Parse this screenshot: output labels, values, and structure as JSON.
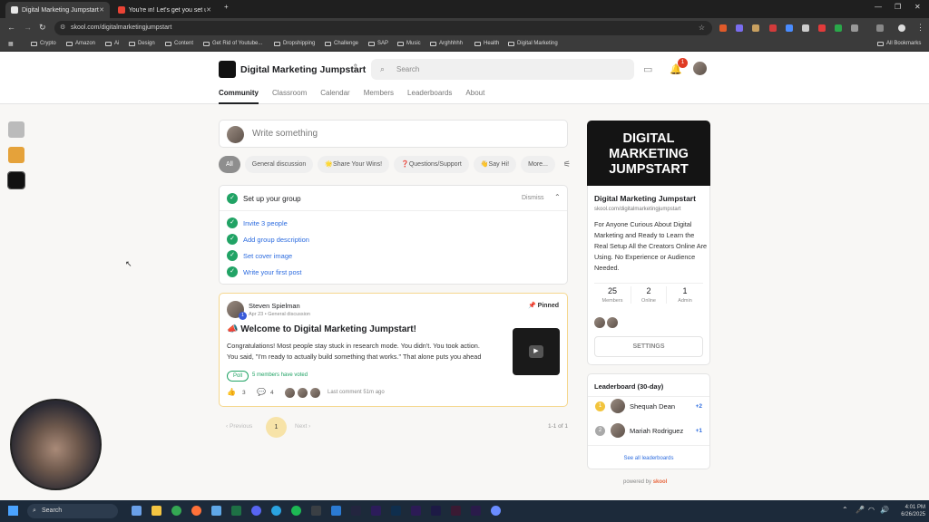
{
  "browser": {
    "tabs": [
      {
        "label": "Digital Marketing Jumpstart",
        "active": true
      },
      {
        "label": "You're in! Let's get you set up...",
        "active": false
      }
    ],
    "url": "skool.com/digitalmarketingjumpstart",
    "bookmarks": [
      "Crypto",
      "Amazon",
      "Ai",
      "Design",
      "Content",
      "Get Rid of Youtube...",
      "Dropshipping",
      "Challenge",
      "SAP",
      "Music",
      "Arghhhhh",
      "Health",
      "Digital Marketing"
    ],
    "all_bookmarks_label": "All Bookmarks"
  },
  "header": {
    "group_name": "Digital Marketing Jumpstart",
    "search_placeholder": "Search",
    "notification_count": "1",
    "tabs": [
      "Community",
      "Classroom",
      "Calendar",
      "Members",
      "Leaderboards",
      "About"
    ]
  },
  "composer": {
    "placeholder": "Write something"
  },
  "filters": [
    "All",
    "General discussion",
    "🌟Share Your Wins!",
    "❓Questions/Support",
    "👋Say Hi!",
    "More..."
  ],
  "setup": {
    "title": "Set up your group",
    "dismiss_label": "Dismiss",
    "items": [
      "Invite 3 people",
      "Add group description",
      "Set cover image",
      "Write your first post"
    ]
  },
  "post": {
    "author": "Steven Spielman",
    "author_level": "1",
    "date": "Apr 23",
    "category": "General discussion",
    "pinned_label": "Pinned",
    "title": "📣 Welcome to Digital Marketing Jumpstart!",
    "body": "Congratulations! Most people stay stuck in research mode. You didn't. You took action. You said, \"I'm ready to actually build something that works.\" That alone puts you ahead",
    "poll_label": "Poll",
    "votes_text": "5 members have voted",
    "likes": "3",
    "comments": "4",
    "last_comment": "Last comment 51m ago"
  },
  "pagination": {
    "previous": "Previous",
    "current": "1",
    "next": "Next",
    "range": "1-1 of 1"
  },
  "about": {
    "cover_text": [
      "DIGITAL",
      "MARKETING",
      "JUMPSTART"
    ],
    "name": "Digital Marketing Jumpstart",
    "url": "skool.com/digitalmarketingjumpstart",
    "description": "For Anyone Curious About Digital Marketing and Ready to Learn the Real Setup All the Creators Online Are Using. No Experience or Audience Needed.",
    "stats": [
      {
        "value": "25",
        "label": "Members"
      },
      {
        "value": "2",
        "label": "Online"
      },
      {
        "value": "1",
        "label": "Admin"
      }
    ],
    "settings_label": "SETTINGS"
  },
  "leaderboard": {
    "title": "Leaderboard (30-day)",
    "entries": [
      {
        "rank": "1",
        "name": "Shequah Dean",
        "points": "+2"
      },
      {
        "rank": "2",
        "name": "Mariah Rodriguez",
        "points": "+1"
      }
    ],
    "see_all": "See all leaderboards"
  },
  "footer": {
    "powered_by": "powered by",
    "brand": "skool"
  },
  "taskbar": {
    "search_label": "Search",
    "time": "4:01 PM",
    "date": "6/26/2025"
  }
}
